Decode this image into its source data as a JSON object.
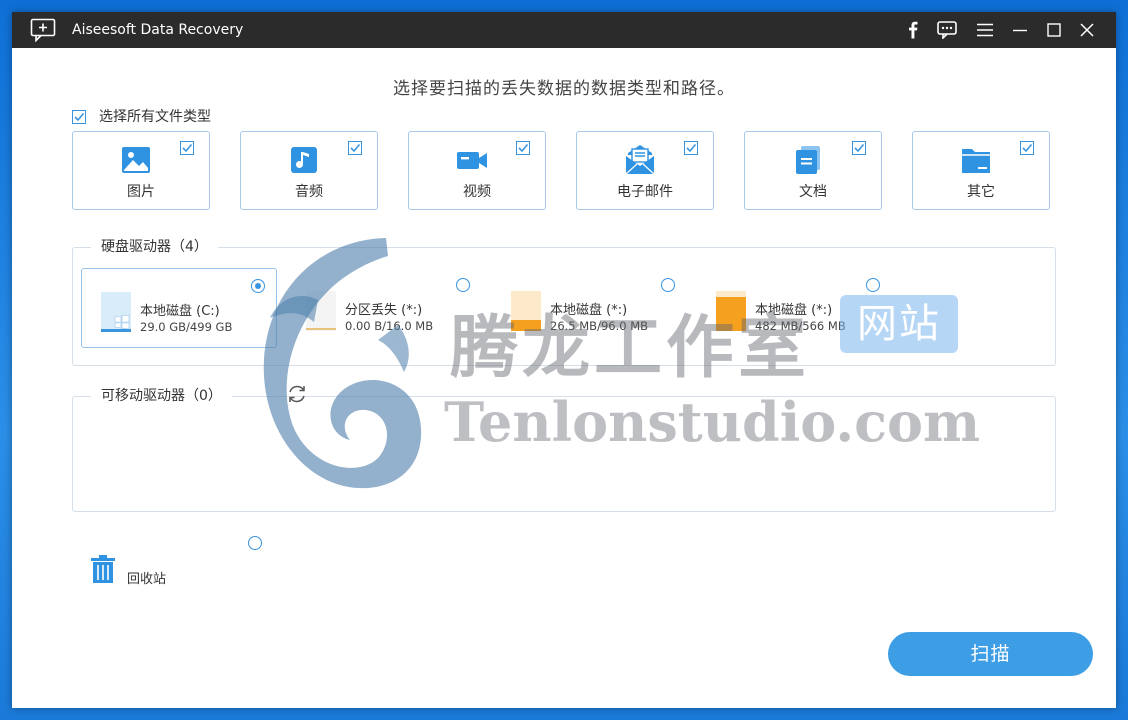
{
  "titlebar": {
    "title": "Aiseesoft Data Recovery"
  },
  "heading": "选择要扫描的丢失数据的数据类型和路径。",
  "select_all": {
    "label": "选择所有文件类型",
    "checked": true
  },
  "file_types": [
    {
      "label": "图片",
      "icon": "image-icon",
      "checked": true
    },
    {
      "label": "音频",
      "icon": "music-note-icon",
      "checked": true
    },
    {
      "label": "视频",
      "icon": "video-camera-icon",
      "checked": true
    },
    {
      "label": "电子邮件",
      "icon": "email-icon",
      "checked": true
    },
    {
      "label": "文档",
      "icon": "document-icon",
      "checked": true
    },
    {
      "label": "其它",
      "icon": "folder-icon",
      "checked": true
    }
  ],
  "hard_drives": {
    "title": "硬盘驱动器（4）",
    "drives": [
      {
        "name": "本地磁盘 (C:)",
        "size": "29.0 GB/499 GB",
        "icon": "windows-drive-icon",
        "selected": true,
        "fill": 0.06
      },
      {
        "name": "分区丢失 (*:)",
        "size": "0.00  B/16.0 MB",
        "icon": "lost-partition-icon",
        "selected": false,
        "fill": 0.0
      },
      {
        "name": "本地磁盘 (*:)",
        "size": "26.5 MB/96.0 MB",
        "icon": "drive-icon",
        "selected": false,
        "fill": 0.28
      },
      {
        "name": "本地磁盘 (*:)",
        "size": "482 MB/566 MB",
        "icon": "drive-icon",
        "selected": false,
        "fill": 0.85
      }
    ]
  },
  "removable_drives": {
    "title": "可移动驱动器（0）"
  },
  "recycle_bin": {
    "label": "回收站",
    "selected": false
  },
  "scan_button": "扫描",
  "watermark": {
    "cn": "腾龙工作室",
    "badge": "网站",
    "en": "Tenlonstudio.com"
  },
  "colors": {
    "accent": "#3d9de5",
    "titlebar": "#2b2b2b",
    "drive_fill": "#f5a01e"
  }
}
